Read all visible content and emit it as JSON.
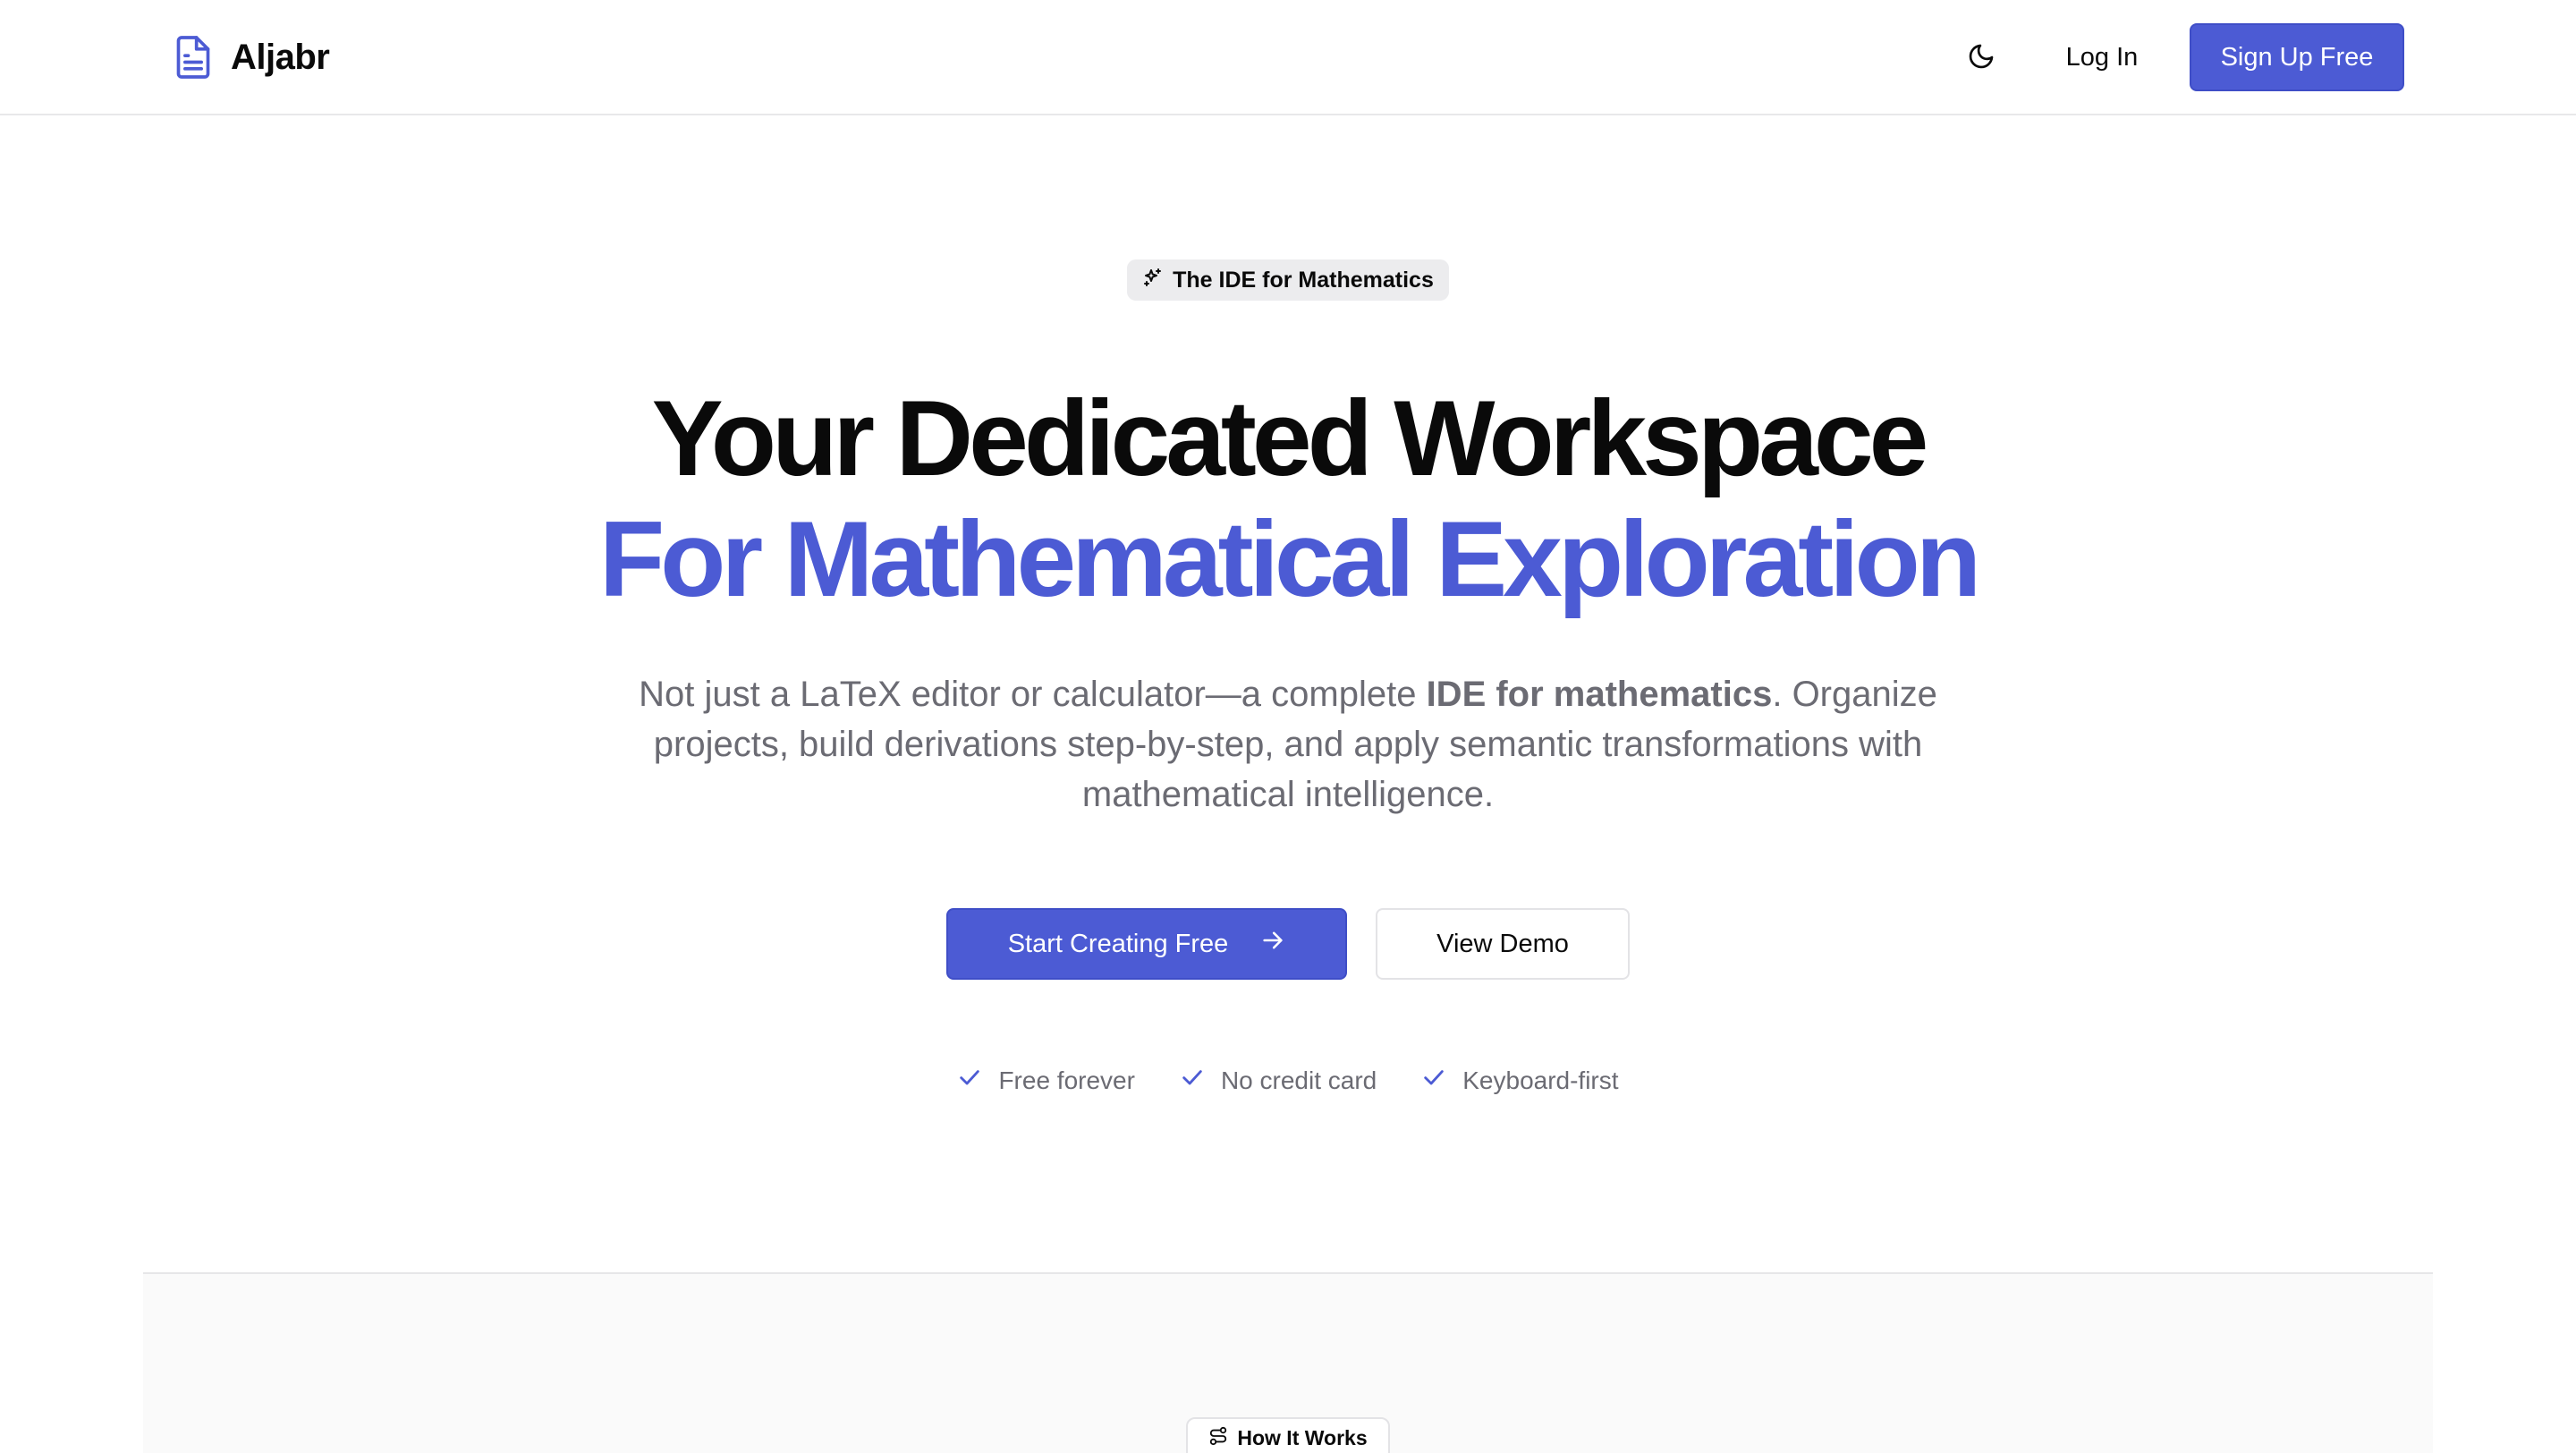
{
  "header": {
    "brand_name": "Aljabr",
    "brand_icon": "document-icon",
    "theme_icon": "moon-icon",
    "login_label": "Log In",
    "signup_label": "Sign Up Free"
  },
  "hero": {
    "badge_label": "The IDE for Mathematics",
    "badge_icon": "sparkles-icon",
    "title_line1": "Your Dedicated Workspace",
    "title_line2": "For Mathematical Exploration",
    "subtitle_before": "Not just a LaTeX editor or calculator—a complete ",
    "subtitle_bold": "IDE for mathematics",
    "subtitle_after": ". Organize projects, build derivations step-by-step, and apply semantic transformations with mathematical intelligence.",
    "primary_cta": "Start Creating Free",
    "secondary_cta": "View Demo",
    "features": [
      "Free forever",
      "No credit card",
      "Keyboard-first"
    ]
  },
  "section": {
    "badge_label": "How It Works",
    "badge_icon": "route-icon"
  },
  "colors": {
    "accent": "#4c5bd4",
    "text": "#0a0a0a",
    "muted": "#6b6b73",
    "border": "#e8e8ea"
  }
}
